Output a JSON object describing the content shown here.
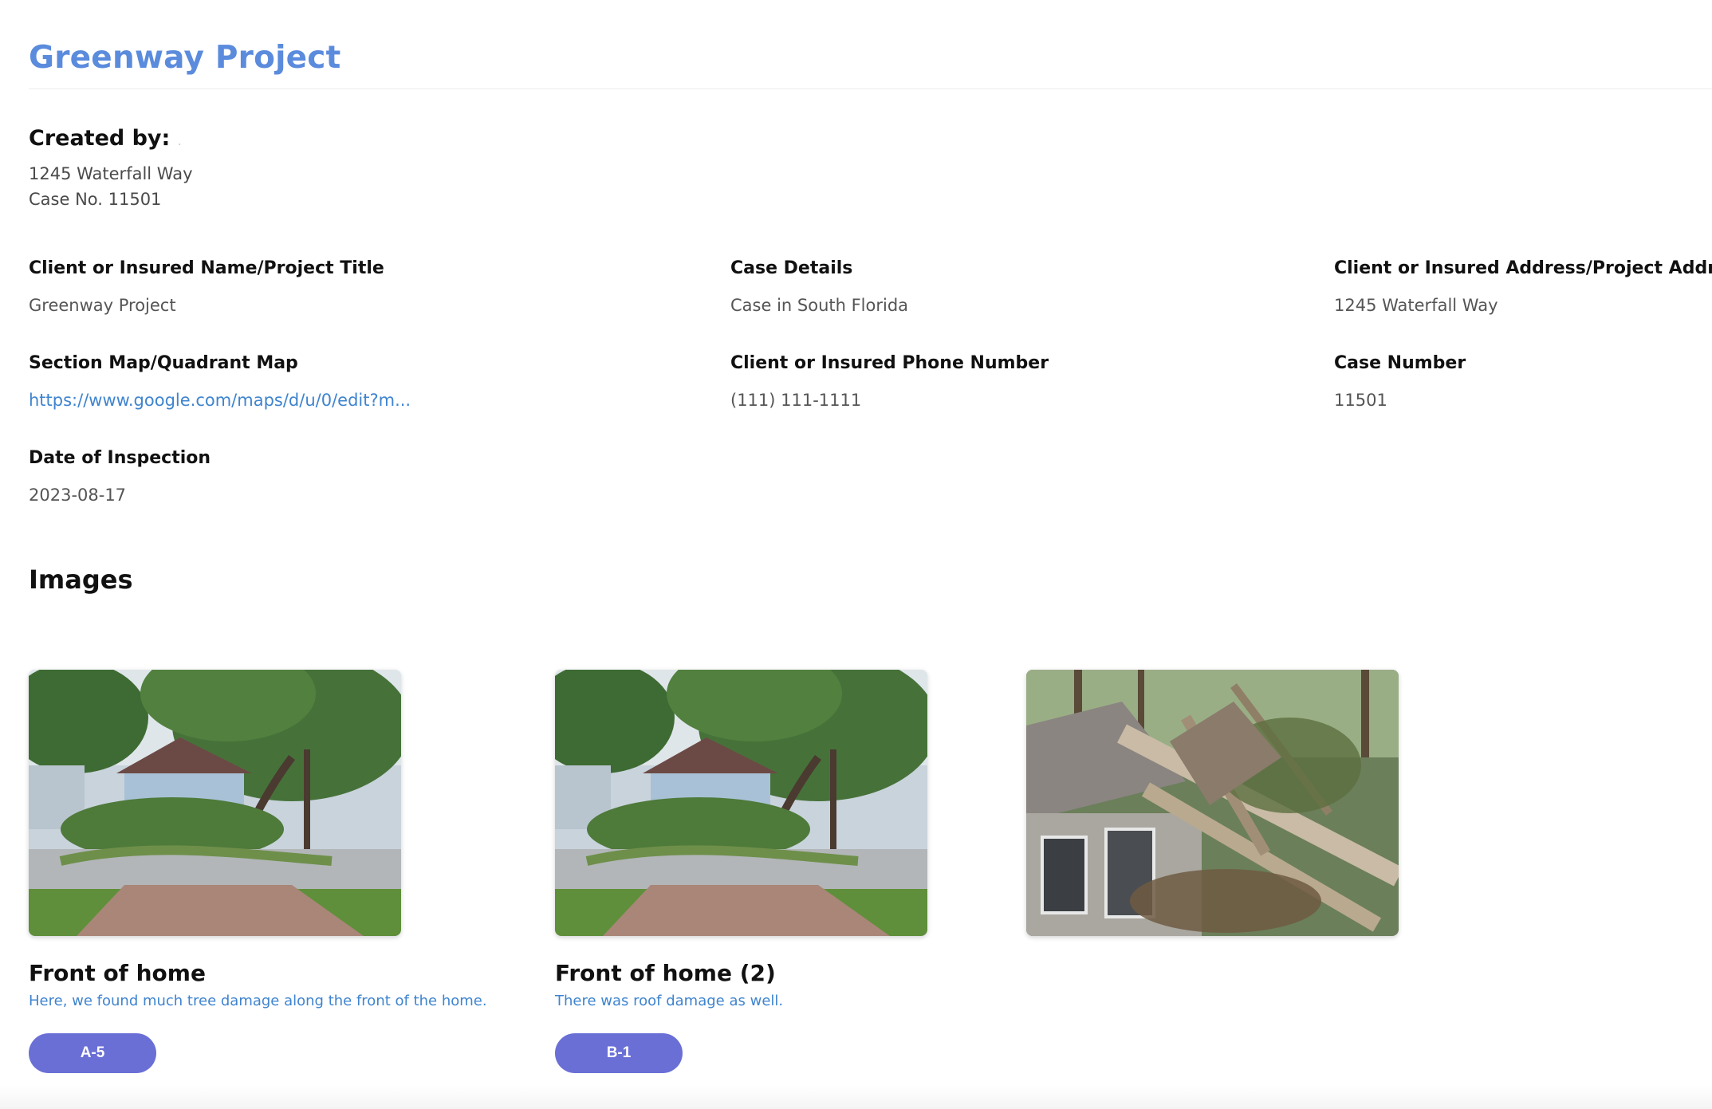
{
  "project": {
    "title": "Greenway Project",
    "created_by_label": "Created by:",
    "created_by_value": ".",
    "address_line": "1245 Waterfall Way",
    "case_line": "Case No. 11501"
  },
  "fields": [
    {
      "label": "Client or Insured Name/Project Title",
      "value": "Greenway Project"
    },
    {
      "label": "Case Details",
      "value": "Case in South Florida"
    },
    {
      "label": "Client or Insured Address/Project Address",
      "value": "1245 Waterfall Way"
    },
    {
      "label": "Section Map/Quadrant Map",
      "value": "https://www.google.com/maps/d/u/0/edit?m..."
    },
    {
      "label": "Client or Insured Phone Number",
      "value": "(111) 111-1111"
    },
    {
      "label": "Case Number",
      "value": "11501"
    },
    {
      "label": "Date of Inspection",
      "value": "2023-08-17"
    }
  ],
  "images_section": {
    "heading": "Images",
    "items": [
      {
        "caption": "Front of home",
        "description": "Here, we found much tree damage along the front of the home.",
        "tag": "A-5"
      },
      {
        "caption": "Front of home (2)",
        "description": "There was roof damage as well.",
        "tag": "B-1"
      },
      {
        "caption": "",
        "description": "",
        "tag": ""
      }
    ]
  },
  "colors": {
    "title": "#5b8bdc",
    "link": "#3f84cf",
    "tag_button": "#6a6fd6"
  }
}
